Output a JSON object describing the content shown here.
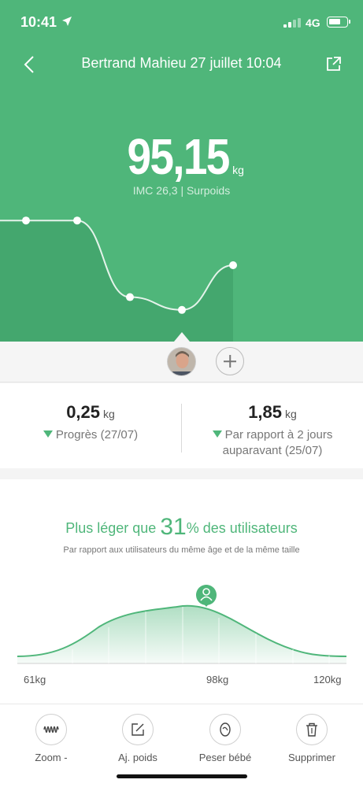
{
  "status_bar": {
    "time": "10:41",
    "network": "4G"
  },
  "header": {
    "title": "Bertrand Mahieu 27 juillet 10:04",
    "weight_value": "95,15",
    "weight_unit": "kg",
    "bmi_text": "IMC 26,3 | Surpoids"
  },
  "colors": {
    "accent": "#4fb67a",
    "accent_dark": "#3fa66a"
  },
  "trend_chart": {
    "points": [
      {
        "x": 0,
        "y": 95.5
      },
      {
        "x": 1,
        "y": 95.5
      },
      {
        "x": 2,
        "y": 94.9
      },
      {
        "x": 3,
        "y": 94.8
      },
      {
        "x": 4,
        "y": 95.15
      }
    ],
    "selected_index": 4
  },
  "changes": {
    "left": {
      "value": "0,25",
      "unit": "kg",
      "desc": "Progrès (27/07)"
    },
    "right": {
      "value": "1,85",
      "unit": "kg",
      "desc": "Par rapport à 2 jours auparavant (25/07)"
    }
  },
  "comparison": {
    "prefix": "Plus léger que ",
    "percent": "31",
    "suffix": "% des utilisateurs",
    "subtitle": "Par rapport aux utilisateurs du même âge et de la même taille",
    "tick_labels": [
      "61kg",
      "98kg",
      "120kg"
    ]
  },
  "toolbar": {
    "items": [
      {
        "label": "Zoom -",
        "icon": "waveform-icon"
      },
      {
        "label": "Aj. poids",
        "icon": "edit-icon"
      },
      {
        "label": "Peser bébé",
        "icon": "baby-icon"
      },
      {
        "label": "Supprimer",
        "icon": "trash-icon"
      }
    ]
  }
}
